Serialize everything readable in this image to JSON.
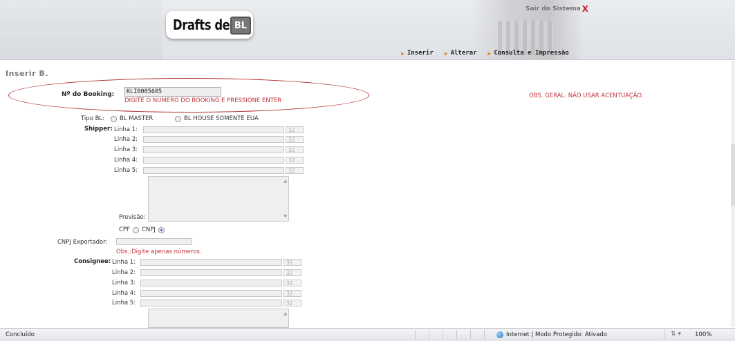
{
  "header": {
    "logo_text": "Drafts de",
    "logo_badge": "BL",
    "exit_label": "Sair do Sistema",
    "exit_icon": "X"
  },
  "nav": [
    {
      "label": "Inserir"
    },
    {
      "label": "Alterar"
    },
    {
      "label": "Consulta e Impressão"
    }
  ],
  "page_title": "Inserir B.",
  "booking": {
    "label": "Nº do Booking:",
    "value": "KLI0005605",
    "hint": "DIGITE O NUMERO DO BOOKING E PRESSIONE ENTER"
  },
  "obs_geral": "OBS. GERAL: NÃO USAR ACENTUAÇÃO.",
  "tipo_bl": {
    "label": "Tipo BL:",
    "options": [
      "BL MASTER",
      "BL HOUSE SOMENTE EUA"
    ]
  },
  "shipper": {
    "label": "Shipper:",
    "lines": [
      "Linha 1:",
      "Linha 2:",
      "Linha 3:",
      "Linha 4:",
      "Linha 5:"
    ],
    "max_chars": "32",
    "previsao": "Previsão:"
  },
  "doc_type": {
    "cpf": "CPF",
    "cnpj": "CNPJ",
    "selected": "CNPJ"
  },
  "cnpj_exportador": {
    "label": "CNPJ Exportador:",
    "obs": "Obs.:Digite apenas números."
  },
  "consignee": {
    "label": "Consignee:",
    "lines": [
      "Linha 1:",
      "Linha 2:",
      "Linha 3:",
      "Linha 4:",
      "Linha 5:"
    ],
    "max_chars": "32"
  },
  "statusbar": {
    "left": "Concluído",
    "zone": "Internet | Modo Protegido: Ativado",
    "zoom": "100%"
  },
  "colors": {
    "accent_red": "#c0333a",
    "nav_arrow": "#e48a15"
  }
}
